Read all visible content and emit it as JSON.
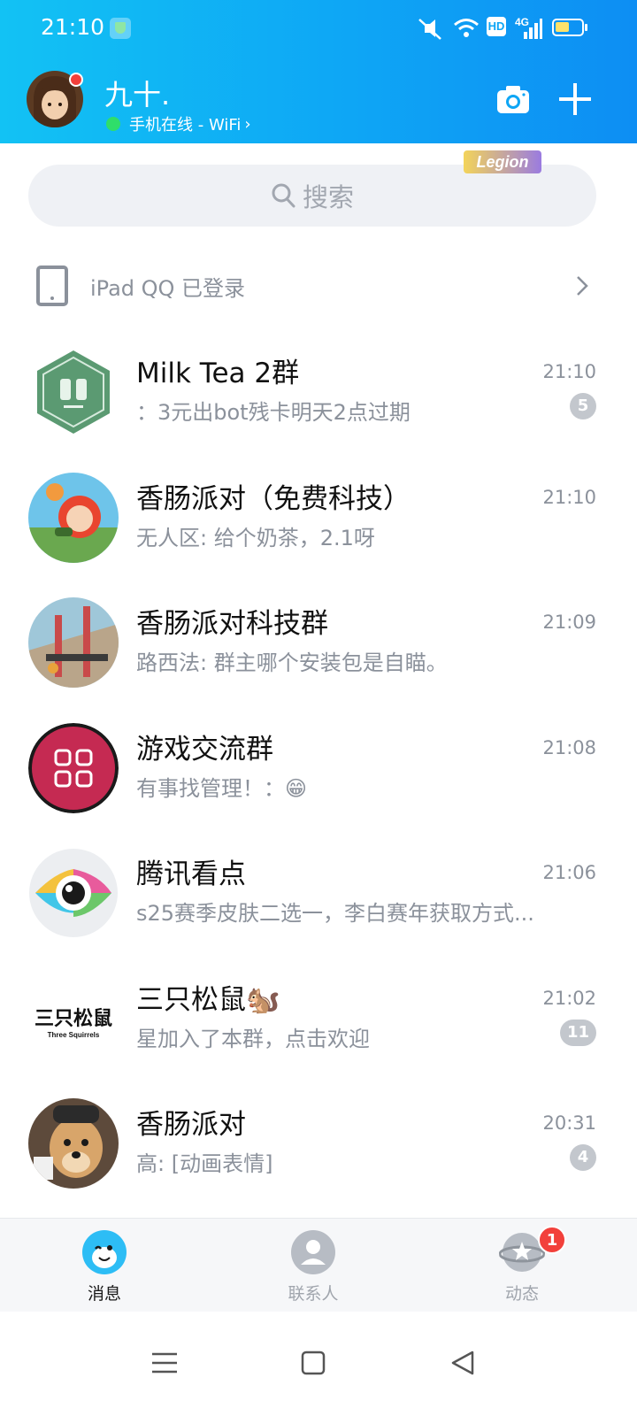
{
  "status_bar": {
    "time": "21:10",
    "hd": "HD",
    "network": "4G",
    "battery_level": 0.55,
    "icons": [
      "shield-icon",
      "mute-icon",
      "wifi-icon",
      "signal-icon",
      "battery-icon"
    ]
  },
  "header": {
    "nickname": "九十.",
    "online_status": "手机在线 - WiFi",
    "online_chevron": "›",
    "actions": [
      "camera-icon",
      "plus-icon"
    ]
  },
  "search": {
    "placeholder": "搜索"
  },
  "device_notice": {
    "text": "iPad QQ 已登录",
    "chevron": "›"
  },
  "chats": [
    {
      "title": "Milk Tea 2群",
      "preview": "    ：3元出bot残卡明天2点过期",
      "time": "21:10",
      "unread": "5"
    },
    {
      "title": "香肠派对（免费科技）",
      "preview": "无人区: 给个奶茶，2.1呀",
      "time": "21:10",
      "tag": "Legion"
    },
    {
      "title": "香肠派对科技群",
      "preview": "路西法: 群主哪个安装包是自瞄。",
      "time": "21:09"
    },
    {
      "title": "游戏交流群",
      "preview": "有事找管理！：😁",
      "time": "21:08"
    },
    {
      "title": "腾讯看点",
      "preview": "s25赛季皮肤二选一，李白赛年获取方式...",
      "time": "21:06"
    },
    {
      "title": "三只松鼠🐿️",
      "preview": "星加入了本群，点击欢迎",
      "time": "21:02",
      "unread": "11"
    },
    {
      "title": "香肠派对",
      "preview": "高: [动画表情]",
      "time": "20:31",
      "unread": "4"
    }
  ],
  "squirrel_logo": {
    "text": "三只松鼠",
    "sub": "Three Squirrels"
  },
  "tabbar": {
    "tabs": [
      {
        "label": "消息",
        "active": true
      },
      {
        "label": "联系人",
        "active": false
      },
      {
        "label": "动态",
        "active": false,
        "badge": "1"
      }
    ],
    "active_color": "#1a1a1a",
    "inactive_color": "#a0a5ad"
  },
  "colors": {
    "header_gradient_start": "#12c2f4",
    "header_gradient_end": "#0d8ef3",
    "badge_red": "#f2403b",
    "muted_text": "#8b919b"
  }
}
